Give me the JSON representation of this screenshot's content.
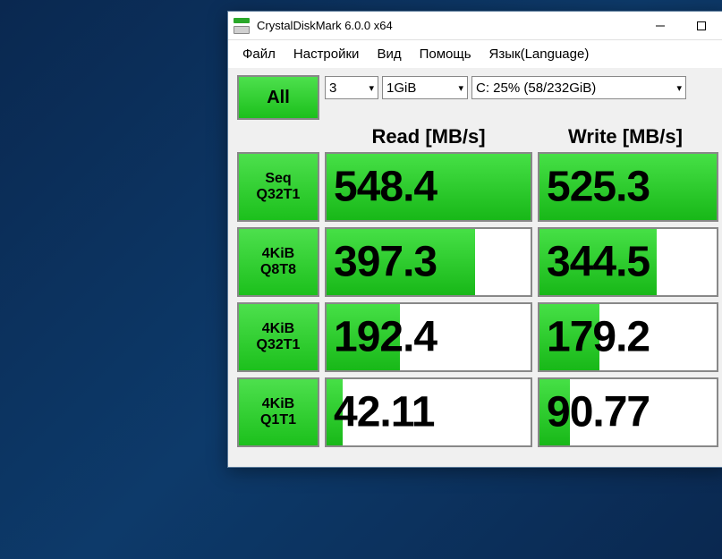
{
  "window": {
    "title": "CrystalDiskMark 6.0.0 x64"
  },
  "menu": {
    "file": "Файл",
    "settings": "Настройки",
    "view": "Вид",
    "help": "Помощь",
    "language": "Язык(Language)"
  },
  "controls": {
    "all_label": "All",
    "count_value": "3",
    "size_value": "1GiB",
    "drive_value": "C: 25% (58/232GiB)"
  },
  "headers": {
    "read": "Read [MB/s]",
    "write": "Write [MB/s]"
  },
  "tests": [
    {
      "label1": "Seq",
      "label2": "Q32T1",
      "read": "548.4",
      "read_pct": 100,
      "write": "525.3",
      "write_pct": 100
    },
    {
      "label1": "4KiB",
      "label2": "Q8T8",
      "read": "397.3",
      "read_pct": 73,
      "write": "344.5",
      "write_pct": 66
    },
    {
      "label1": "4KiB",
      "label2": "Q32T1",
      "read": "192.4",
      "read_pct": 36,
      "write": "179.2",
      "write_pct": 34
    },
    {
      "label1": "4KiB",
      "label2": "Q1T1",
      "read": "42.11",
      "read_pct": 8,
      "write": "90.77",
      "write_pct": 17
    }
  ],
  "chart_data": {
    "type": "bar",
    "title": "CrystalDiskMark 6.0.0 x64",
    "xlabel": "",
    "ylabel": "MB/s",
    "categories": [
      "Seq Q32T1",
      "4KiB Q8T8",
      "4KiB Q32T1",
      "4KiB Q1T1"
    ],
    "series": [
      {
        "name": "Read [MB/s]",
        "values": [
          548.4,
          397.3,
          192.4,
          42.11
        ]
      },
      {
        "name": "Write [MB/s]",
        "values": [
          525.3,
          344.5,
          179.2,
          90.77
        ]
      }
    ],
    "ylim": [
      0,
      600
    ]
  }
}
